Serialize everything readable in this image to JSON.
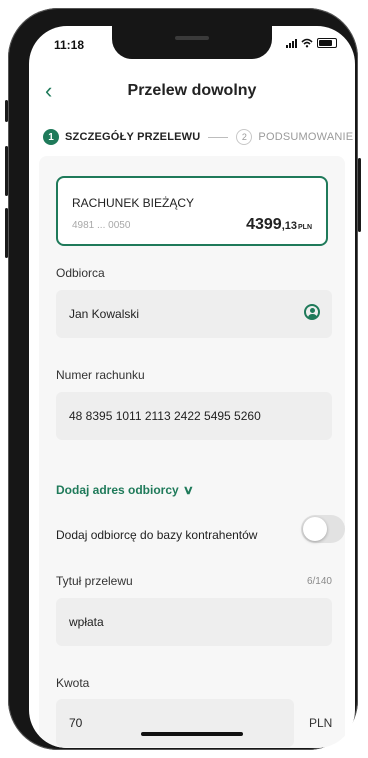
{
  "status_bar": {
    "time": "11:18"
  },
  "header": {
    "title": "Przelew dowolny"
  },
  "steps": [
    {
      "number": "1",
      "label": "SZCZEGÓŁY PRZELEWU"
    },
    {
      "number": "2",
      "label": "PODSUMOWANIE"
    }
  ],
  "account": {
    "name": "RACHUNEK BIEŻĄCY",
    "number": "4981 ... 0050",
    "balance_int": "4399",
    "balance_dec": ",13",
    "currency": "PLN"
  },
  "recipient": {
    "label": "Odbiorca",
    "value": "Jan Kowalski"
  },
  "account_number": {
    "label": "Numer rachunku",
    "value": "48 8395 1011 2113 2422 5495 5260"
  },
  "add_address": {
    "label": "Dodaj adres odbiorcy"
  },
  "add_to_contacts": {
    "label": "Dodaj odbiorcę do bazy kontrahentów",
    "enabled": false
  },
  "transfer_title": {
    "label": "Tytuł przelewu",
    "value": "wpłata",
    "counter": "6/140"
  },
  "amount": {
    "label": "Kwota",
    "value": "70",
    "currency": "PLN"
  },
  "colors": {
    "accent": "#1f7a5a",
    "field_bg": "#eeeeee"
  },
  "icons": [
    "chevron-left-icon",
    "user-circle-icon",
    "chevron-down-icon",
    "signal-icon",
    "wifi-icon",
    "battery-icon"
  ]
}
